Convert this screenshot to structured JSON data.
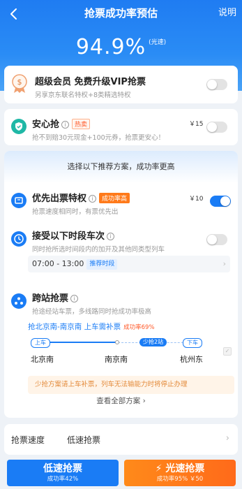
{
  "header": {
    "title": "抢票成功率预估",
    "help": "说明",
    "rate": "94.9%",
    "rate_tag": "(光速)"
  },
  "vip": {
    "title": "超级会员 免费升级VIP抢票",
    "subtitle": "另享京东联名特权+8类精选特权",
    "enabled": false
  },
  "safe": {
    "title": "安心抢",
    "badge": "热卖",
    "subtitle": "抢不到赔30元现金+100元券，抢票更安心！",
    "price": "￥15",
    "enabled": false
  },
  "plans": {
    "header": "选择以下推荐方案，成功率更高",
    "priority": {
      "title": "优先出票特权",
      "badge": "成功率高",
      "subtitle": "抢票速度相同时，有票优先出",
      "price": "￥10",
      "enabled": true
    },
    "time": {
      "title": "接受以下时段车次",
      "subtitle": "同时抢所选时间段内的加开及其他同类型列车",
      "range": "07:00 - 13:00",
      "recommend": "推荐时段",
      "enabled": false
    },
    "cross": {
      "title": "跨站抢票",
      "subtitle": "抢途经站车票，多线路同时抢成功率极高",
      "route_title": "抢北京南-南京南 上车需补票",
      "route_rate": "成功率69%",
      "board_label": "上车",
      "middle_label": "少抢2站",
      "alight_label": "下车",
      "stations": [
        "北京南",
        "南京南",
        "杭州东"
      ],
      "warning": "少抢方案请上车补票，列车无法输能力时将停止办理"
    },
    "view_all": "查看全部方案"
  },
  "speed": {
    "label": "抢票速度",
    "value": "低速抢票"
  },
  "buttons": {
    "low": {
      "label": "低速抢票",
      "sub": "成功率42%"
    },
    "fast": {
      "label": "光速抢票",
      "sub": "成功率95%  ￥50"
    }
  },
  "colors": {
    "accent": "#1a7cf5",
    "orange": "#ff7a1a",
    "warning_bg": "#fff4e8"
  }
}
